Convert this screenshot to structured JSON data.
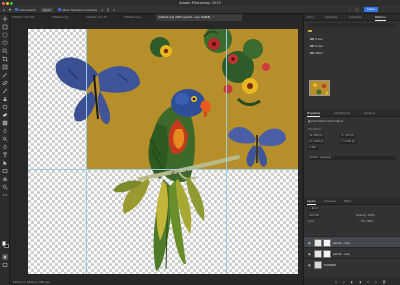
{
  "app": {
    "title": "Adobe Photoshop 2025"
  },
  "options_bar": {
    "auto_select_label": "Auto-Select:",
    "auto_select_value": "Layer",
    "show_transform_label": "Show Transform Controls",
    "share_label": "Share"
  },
  "tabs": [
    {
      "label": "Untitled-1 @ 100...",
      "active": false
    },
    {
      "label": "Untitled-2 @...",
      "active": false
    },
    {
      "label": "Untitled-3 @ 25...",
      "active": false
    },
    {
      "label": "Untitled-4 @...",
      "active": false
    },
    {
      "label": "Untitled-4 @ 200% (parrot - one, RGB/8)",
      "active": true
    }
  ],
  "status_bar": {
    "text": "1000 px x 1000 px (300 ppi)"
  },
  "panels": {
    "top_tabs": [
      "Color",
      "Swatches",
      "Gradients",
      "Patterns"
    ],
    "top_active": "Patterns",
    "pattern_folders": [
      "Trees",
      "Grass",
      "Water"
    ],
    "properties_tabs": [
      "Properties",
      "Adjustments",
      "Libraries"
    ],
    "properties_active": "Properties",
    "smart_object_label": "Embedded Smart Object",
    "transform_label": "Transform",
    "w_value": "W: 500 px",
    "h_value": "H: 1100 px",
    "x_value": "X: 370 px",
    "y_value": "Y: 1730 px",
    "angle_value": "0.00°",
    "smart_name": "parrot - one.png",
    "layers_tabs": [
      "Layers",
      "Channels",
      "Paths"
    ],
    "layers_active": "Layers",
    "kind_label": "Kind",
    "blend_mode": "Normal",
    "opacity_label": "Opacity: 100%",
    "lock_label": "Lock:",
    "fill_label": "Fill: 100%",
    "layers": [
      {
        "name": "parrot - one",
        "selected": true
      },
      {
        "name": "parrot - one",
        "selected": false
      },
      {
        "name": "FLOWER",
        "selected": false
      }
    ]
  },
  "colors": {
    "accent": "#3478f6",
    "mustard": "#b78f2a",
    "panel_bg": "#323232",
    "toolbar_bg": "#2c2c2c"
  }
}
